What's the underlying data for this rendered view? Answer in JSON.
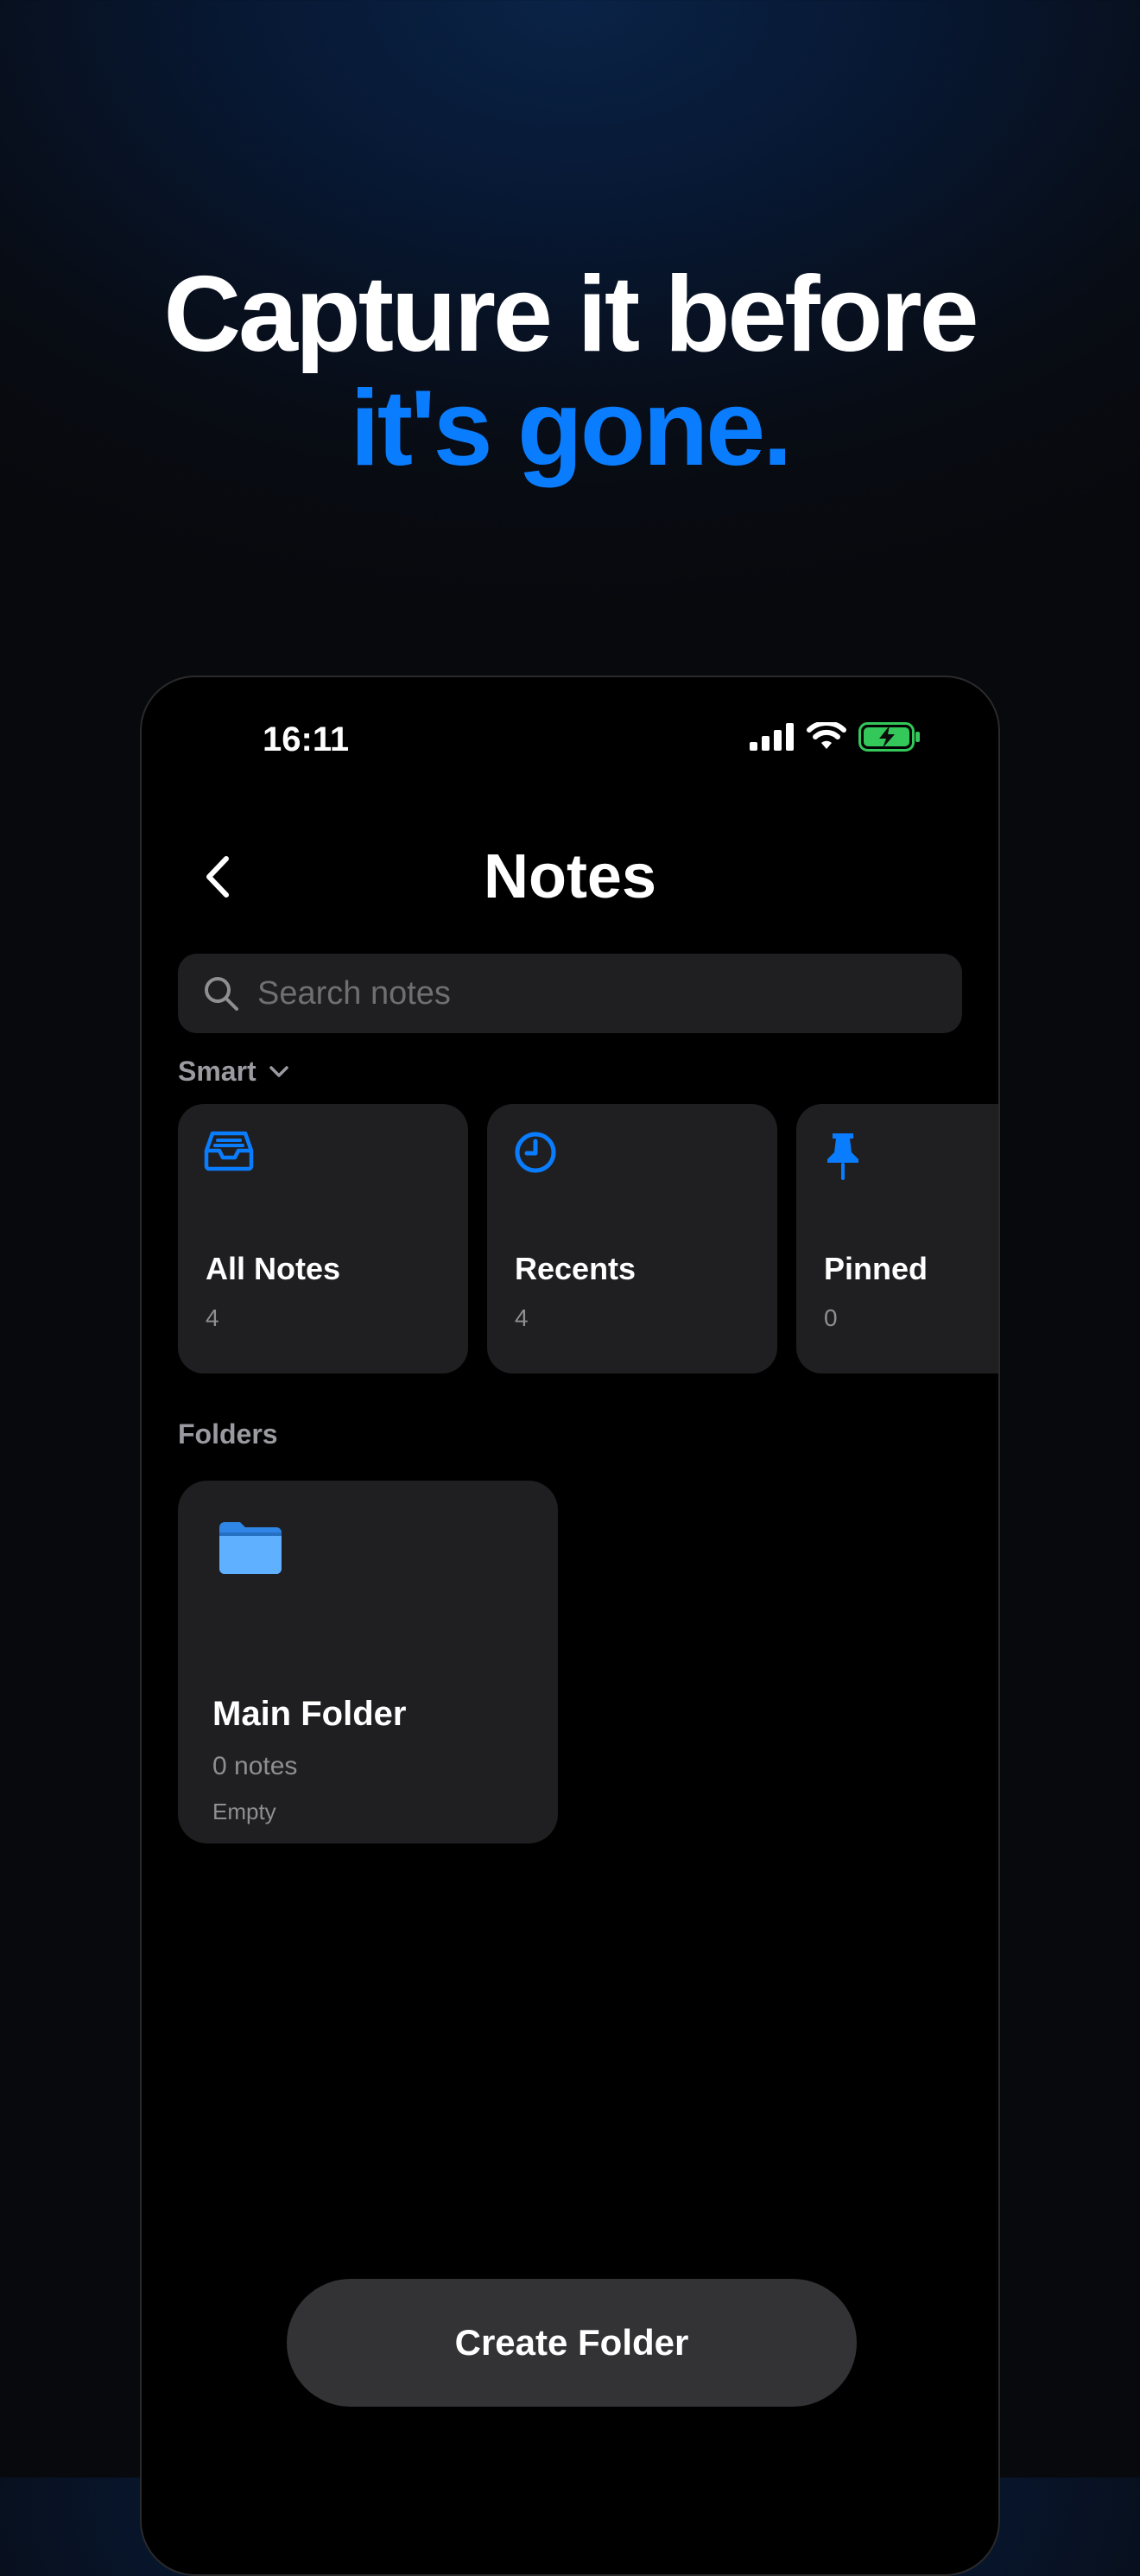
{
  "headline": {
    "line1": "Capture it before",
    "line2": "it's gone."
  },
  "status_bar": {
    "time": "16:11"
  },
  "header": {
    "title": "Notes"
  },
  "search": {
    "placeholder": "Search notes"
  },
  "sections": {
    "smart": "Smart",
    "folders": "Folders"
  },
  "smart_items": [
    {
      "label": "All Notes",
      "count": "4",
      "icon": "tray-icon"
    },
    {
      "label": "Recents",
      "count": "4",
      "icon": "clock-icon"
    },
    {
      "label": "Pinned",
      "count": "0",
      "icon": "pin-icon"
    }
  ],
  "folders": [
    {
      "name": "Main Folder",
      "count": "0 notes",
      "state": "Empty",
      "icon": "folder-icon"
    }
  ],
  "actions": {
    "create_folder": "Create Folder"
  },
  "colors": {
    "accent": "#0a7dff",
    "card": "#1f1f21",
    "button": "#333335",
    "battery": "#34c759"
  }
}
